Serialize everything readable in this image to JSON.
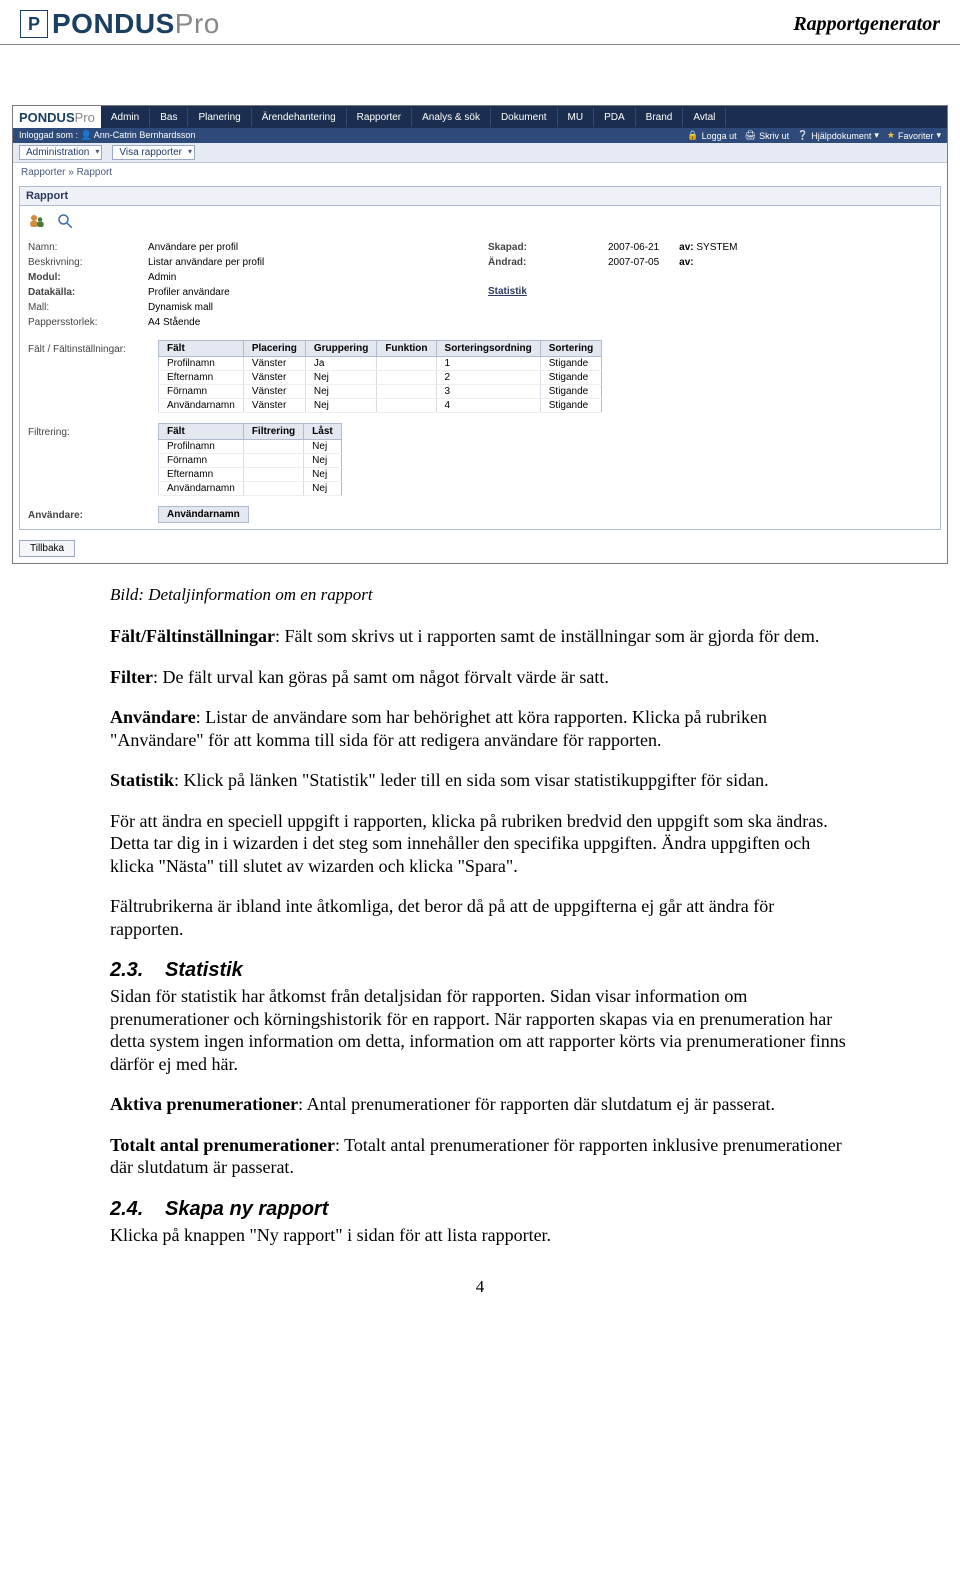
{
  "header": {
    "logo_main": "PONDUS",
    "logo_suffix": "Pro",
    "doc_title": "Rapportgenerator"
  },
  "app": {
    "brand_main": "PONDUS",
    "brand_suffix": "Pro",
    "mainnav": [
      "Admin",
      "Bas",
      "Planering",
      "Ärendehantering",
      "Rapporter",
      "Analys & sök",
      "Dokument",
      "MU",
      "PDA",
      "Brand",
      "Avtal"
    ],
    "login_label": "Inloggad som :",
    "login_user": "Ann-Catrin Bernhardsson",
    "toplinks": {
      "logout": "Logga ut",
      "print": "Skriv ut",
      "help": "Hjälpdokument",
      "fav": "Favoriter"
    },
    "thirdbar": {
      "admin": "Administration",
      "visa": "Visa rapporter"
    },
    "breadcrumb": "Rapporter » Rapport",
    "panel_title": "Rapport",
    "meta_left_labels": [
      "Namn:",
      "Beskrivning:",
      "Modul:",
      "Datakälla:",
      "Mall:",
      "Pappersstorlek:"
    ],
    "meta_left_values": [
      "Användare per profil",
      "Listar användare per profil",
      "Admin",
      "Profiler användare",
      "Dynamisk mall",
      "A4 Stående"
    ],
    "meta_right": [
      {
        "k": "Skapad:",
        "v": "2007-06-21",
        "k2": "av:",
        "v2": "SYSTEM"
      },
      {
        "k": "Ändrad:",
        "v": "2007-07-05",
        "k2": "av:",
        "v2": ""
      }
    ],
    "statistik_link": "Statistik",
    "falt_label": "Fält / Fältinställningar:",
    "falt_headers": [
      "Fält",
      "Placering",
      "Gruppering",
      "Funktion",
      "Sorteringsordning",
      "Sortering"
    ],
    "falt_rows": [
      [
        "Profilnamn",
        "Vänster",
        "Ja",
        "",
        "1",
        "Stigande"
      ],
      [
        "Efternamn",
        "Vänster",
        "Nej",
        "",
        "2",
        "Stigande"
      ],
      [
        "Förnamn",
        "Vänster",
        "Nej",
        "",
        "3",
        "Stigande"
      ],
      [
        "Användarnamn",
        "Vänster",
        "Nej",
        "",
        "4",
        "Stigande"
      ]
    ],
    "filter_label": "Filtrering:",
    "filter_headers": [
      "Fält",
      "Filtrering",
      "Låst"
    ],
    "filter_rows": [
      [
        "Profilnamn",
        "",
        "Nej"
      ],
      [
        "Förnamn",
        "",
        "Nej"
      ],
      [
        "Efternamn",
        "",
        "Nej"
      ],
      [
        "Användarnamn",
        "",
        "Nej"
      ]
    ],
    "anv_label": "Användare:",
    "anv_header": "Användarnamn",
    "back": "Tillbaka"
  },
  "doc": {
    "caption": "Bild: Detaljinformation om en rapport",
    "p1_b": "Fält/Fältinställningar",
    "p1_rest": ": Fält som skrivs ut i rapporten samt de inställningar som är gjorda för dem.",
    "p2_b": "Filter",
    "p2_rest": ": De fält urval kan göras på samt om något förvalt värde är satt.",
    "p3_b": "Användare",
    "p3_rest": ": Listar de användare som har behörighet att köra rapporten. Klicka på rubriken \"Användare\" för att komma till sida för att redigera användare för rapporten.",
    "p4_b": "Statistik",
    "p4_rest": ": Klick på länken \"Statistik\" leder till en sida som visar statistikuppgifter för sidan.",
    "p5": "För att ändra en speciell uppgift i rapporten, klicka på rubriken bredvid den uppgift som ska ändras. Detta tar dig in i wizarden i det steg som innehåller den specifika uppgiften. Ändra uppgiften och klicka \"Nästa\" till slutet av wizarden och klicka \"Spara\".",
    "p6": "Fältrubrikerna är ibland inte åtkomliga, det beror då på att de uppgifterna ej går att ändra för rapporten.",
    "h23_num": "2.3.",
    "h23_txt": "Statistik",
    "p7": "Sidan för statistik har åtkomst från detaljsidan för rapporten. Sidan visar information om prenumerationer och körningshistorik för en rapport. När rapporten skapas via en prenumeration har detta system ingen information om detta, information om att rapporter körts via prenumerationer finns därför ej med här.",
    "p8_b": "Aktiva prenumerationer",
    "p8_rest": ": Antal prenumerationer för rapporten där slutdatum ej är passerat.",
    "p9_b": "Totalt antal prenumerationer",
    "p9_rest": ": Totalt antal prenumerationer för rapporten inklusive prenumerationer där slutdatum är passerat.",
    "h24_num": "2.4.",
    "h24_txt": "Skapa ny rapport",
    "p10": "Klicka på knappen \"Ny rapport\" i sidan för att lista rapporter.",
    "page_num": "4"
  }
}
